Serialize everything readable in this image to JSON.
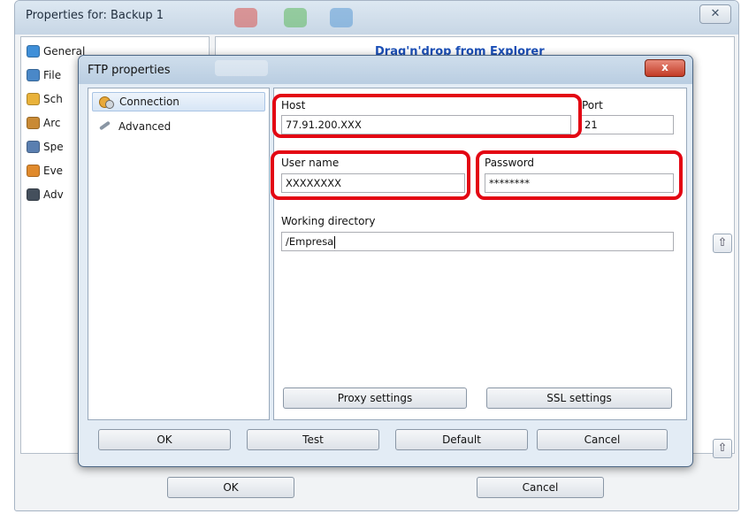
{
  "outer": {
    "title": "Properties for: Backup 1",
    "close_label": "✕",
    "nav": [
      {
        "label": "General",
        "icon": "general-icon",
        "color": "#3f8fd8"
      },
      {
        "label": "File",
        "icon": "files-icon",
        "color": "#4a88c8"
      },
      {
        "label": "Sch",
        "icon": "schedule-icon",
        "color": "#e9b23a"
      },
      {
        "label": "Arc",
        "icon": "archive-icon",
        "color": "#c98a35"
      },
      {
        "label": "Spe",
        "icon": "speed-icon",
        "color": "#5a7fb0"
      },
      {
        "label": "Eve",
        "icon": "events-icon",
        "color": "#e08a2c"
      },
      {
        "label": "Adv",
        "icon": "advanced-icon",
        "color": "#444f5c"
      }
    ],
    "drag_link": "Drag'n'drop from Explorer",
    "arrow_up": "⇧",
    "buttons": {
      "ok": "OK",
      "cancel": "Cancel"
    }
  },
  "dialog": {
    "title": "FTP properties",
    "close_label": "x",
    "tree": [
      {
        "label": "Connection",
        "icon": "connection-icon"
      },
      {
        "label": "Advanced",
        "icon": "advanced-icon"
      }
    ],
    "fields": {
      "host_label": "Host",
      "host_value": "77.91.200.XXX",
      "port_label": "Port",
      "port_value": "21",
      "user_label": "User name",
      "user_value": "XXXXXXXX",
      "password_label": "Password",
      "password_value": "********",
      "dir_label": "Working directory",
      "dir_value": "/Empresa"
    },
    "buttons": {
      "proxy": "Proxy settings",
      "ssl": "SSL settings",
      "ok": "OK",
      "test": "Test",
      "default": "Default",
      "cancel": "Cancel"
    }
  },
  "colors": {
    "highlight": "#e30613",
    "link": "#1a4fb8",
    "close": "#c33b26"
  }
}
